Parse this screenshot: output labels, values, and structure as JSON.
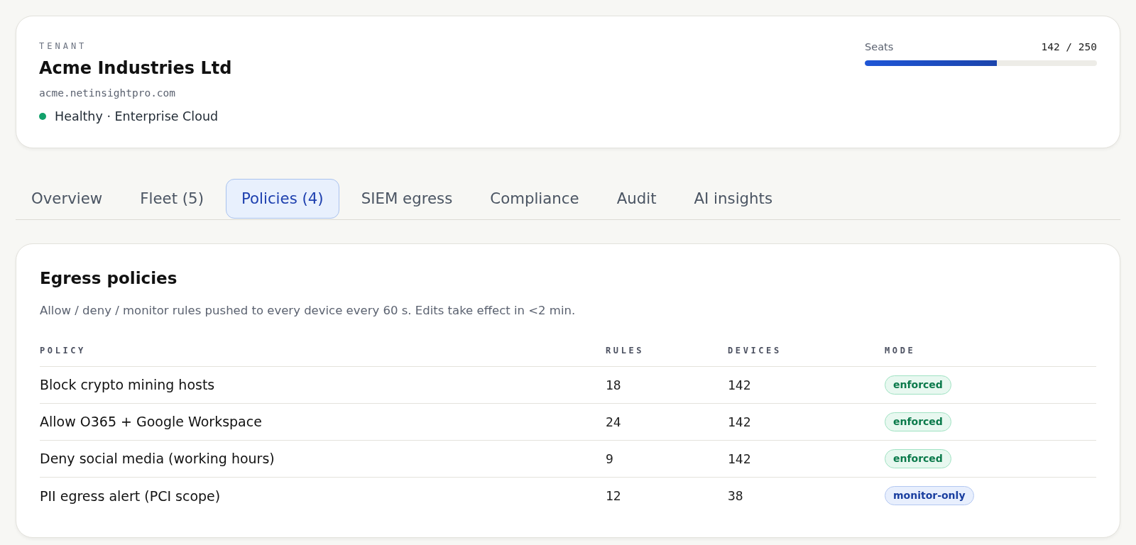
{
  "tenant": {
    "label": "TENANT",
    "name": "Acme Industries Ltd",
    "domain": "acme.netinsightpro.com",
    "status": {
      "text": "Healthy · Enterprise Cloud",
      "color": "#12a16b"
    },
    "seats": {
      "label": "Seats",
      "count": "142 / 250",
      "level": 0.568
    }
  },
  "tabs": [
    {
      "label": "Overview",
      "selected": false
    },
    {
      "label": "Fleet (5)",
      "selected": false
    },
    {
      "label": "Policies (4)",
      "selected": true
    },
    {
      "label": "SIEM egress",
      "selected": false
    },
    {
      "label": "Compliance",
      "selected": false
    },
    {
      "label": "Audit",
      "selected": false
    },
    {
      "label": "AI insights",
      "selected": false
    }
  ],
  "policies": {
    "title": "Egress policies",
    "description": "Allow / deny / monitor rules pushed to every device every 60 s. Edits take effect in <2 min.",
    "table": {
      "columns": [
        "POLICY",
        "RULES",
        "DEVICES",
        "MODE"
      ],
      "rows": [
        {
          "policy": "Block crypto mining hosts",
          "rules": "18",
          "devices": "142",
          "mode": {
            "text": "enforced",
            "kind": "enforced"
          }
        },
        {
          "policy": "Allow O365 + Google Workspace",
          "rules": "24",
          "devices": "142",
          "mode": {
            "text": "enforced",
            "kind": "enforced"
          }
        },
        {
          "policy": "Deny social media (working hours)",
          "rules": "9",
          "devices": "142",
          "mode": {
            "text": "enforced",
            "kind": "enforced"
          }
        },
        {
          "policy": "PII egress alert (PCI scope)",
          "rules": "12",
          "devices": "38",
          "mode": {
            "text": "monitor-only",
            "kind": "monitor"
          }
        }
      ]
    }
  }
}
